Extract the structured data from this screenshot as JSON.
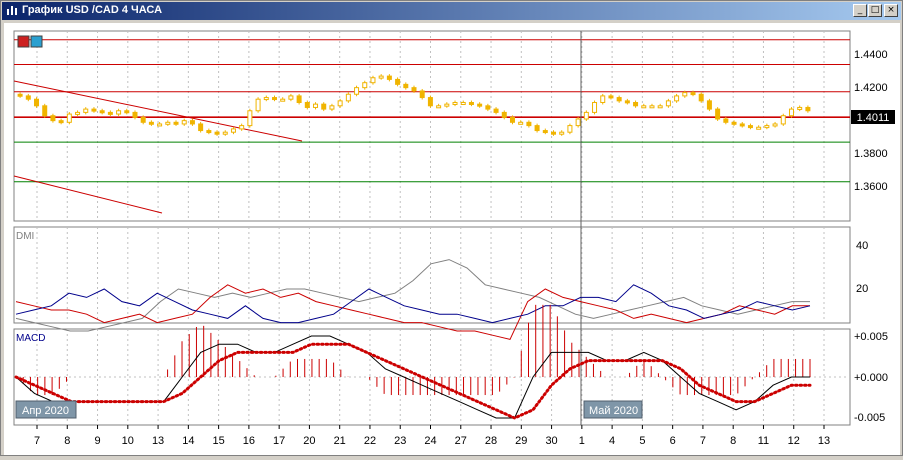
{
  "window": {
    "title": "График USD /CAD  4 ЧАСА",
    "controls": {
      "minimize": "_",
      "maximize": "□",
      "close": "×"
    }
  },
  "colors": {
    "candle": "#f0b400",
    "resistance": "#cc0000",
    "support": "#008000",
    "dmi_plus": "#00008b",
    "dmi_minus": "#cc0000",
    "adx": "#808080",
    "macd_line": "#000000",
    "signal": "#cc0000"
  },
  "price_panel": {
    "current_price": "1.4011",
    "ticks": [
      "1.4400",
      "1.4200",
      "1.3800",
      "1.3600"
    ]
  },
  "dmi_panel": {
    "label": "DMI",
    "ticks": [
      "40",
      "20"
    ]
  },
  "macd_panel": {
    "label": "MACD",
    "ticks": [
      "+0.005",
      "+0.000",
      "-0.005"
    ]
  },
  "month_labels": [
    "Апр 2020",
    "Май 2020"
  ],
  "x_axis": {
    "dates": [
      "7",
      "8",
      "9",
      "10",
      "13",
      "14",
      "15",
      "16",
      "17",
      "20",
      "21",
      "22",
      "23",
      "24",
      "27",
      "28",
      "29",
      "30",
      "1",
      "4",
      "5",
      "6",
      "7",
      "8",
      "11",
      "12",
      "13"
    ]
  },
  "chart_data": {
    "type": "candlestick",
    "price_levels": {
      "red": [
        1.448,
        1.433,
        1.4165,
        1.4011
      ],
      "green": [
        1.386,
        1.362
      ],
      "ylim": [
        1.34,
        1.46
      ]
    },
    "close": [
      1.414,
      1.412,
      1.408,
      1.402,
      1.399,
      1.398,
      1.403,
      1.404,
      1.406,
      1.405,
      1.404,
      1.403,
      1.405,
      1.404,
      1.401,
      1.398,
      1.397,
      1.397,
      1.398,
      1.397,
      1.399,
      1.397,
      1.393,
      1.392,
      1.391,
      1.392,
      1.394,
      1.396,
      1.405,
      1.412,
      1.413,
      1.412,
      1.412,
      1.414,
      1.41,
      1.407,
      1.409,
      1.406,
      1.408,
      1.411,
      1.415,
      1.419,
      1.422,
      1.425,
      1.426,
      1.424,
      1.421,
      1.419,
      1.417,
      1.413,
      1.408,
      1.408,
      1.409,
      1.41,
      1.41,
      1.409,
      1.408,
      1.406,
      1.404,
      1.401,
      1.398,
      1.398,
      1.396,
      1.393,
      1.392,
      1.391,
      1.392,
      1.396,
      1.4,
      1.404,
      1.41,
      1.414,
      1.413,
      1.411,
      1.41,
      1.408,
      1.408,
      1.408,
      1.408,
      1.411,
      1.414,
      1.416,
      1.415,
      1.411,
      1.406,
      1.4,
      1.398,
      1.397,
      1.396,
      1.395,
      1.395,
      1.396,
      1.397,
      1.402,
      1.406,
      1.407,
      1.405
    ],
    "dmi_plus": [
      18,
      20,
      22,
      28,
      26,
      30,
      24,
      22,
      28,
      24,
      20,
      18,
      16,
      22,
      16,
      14,
      14,
      16,
      18,
      24,
      30,
      26,
      22,
      20,
      18,
      18,
      16,
      14,
      16,
      18,
      22,
      22,
      26,
      26,
      24,
      32,
      28,
      22,
      20,
      16,
      18,
      20,
      24,
      22,
      20,
      22
    ],
    "dmi_minus": [
      24,
      22,
      20,
      20,
      18,
      14,
      16,
      18,
      14,
      16,
      18,
      26,
      32,
      28,
      30,
      26,
      28,
      24,
      22,
      20,
      18,
      16,
      14,
      14,
      12,
      10,
      10,
      8,
      6,
      24,
      30,
      26,
      24,
      22,
      20,
      16,
      18,
      16,
      14,
      16,
      18,
      22,
      20,
      18,
      22,
      22
    ],
    "adx": [
      16,
      14,
      12,
      10,
      10,
      12,
      14,
      16,
      24,
      30,
      28,
      26,
      28,
      26,
      28,
      30,
      30,
      28,
      26,
      24,
      26,
      28,
      34,
      42,
      44,
      40,
      32,
      30,
      28,
      26,
      22,
      18,
      16,
      18,
      20,
      22,
      24,
      26,
      22,
      20,
      18,
      20,
      22,
      24,
      24
    ],
    "macd": [
      0.0,
      -0.002,
      -0.003,
      -0.003,
      -0.003,
      -0.003,
      -0.003,
      -0.003,
      -0.003,
      0.0,
      0.003,
      0.004,
      0.004,
      0.003,
      0.003,
      0.004,
      0.005,
      0.005,
      0.004,
      0.003,
      0.001,
      0.0,
      -0.001,
      -0.002,
      -0.003,
      -0.004,
      -0.005,
      -0.005,
      0.0,
      0.003,
      0.003,
      0.003,
      0.002,
      0.002,
      0.003,
      0.002,
      0.0,
      -0.002,
      -0.003,
      -0.004,
      -0.003,
      -0.001,
      0.0,
      0.0
    ],
    "signal": [
      0.0,
      -0.001,
      -0.002,
      -0.003,
      -0.003,
      -0.003,
      -0.003,
      -0.003,
      -0.003,
      -0.002,
      0.0,
      0.002,
      0.003,
      0.003,
      0.003,
      0.003,
      0.004,
      0.004,
      0.004,
      0.003,
      0.002,
      0.001,
      0.0,
      -0.001,
      -0.002,
      -0.003,
      -0.004,
      -0.005,
      -0.004,
      -0.001,
      0.001,
      0.002,
      0.002,
      0.002,
      0.002,
      0.002,
      0.001,
      -0.001,
      -0.002,
      -0.003,
      -0.003,
      -0.002,
      -0.001,
      -0.001
    ]
  }
}
